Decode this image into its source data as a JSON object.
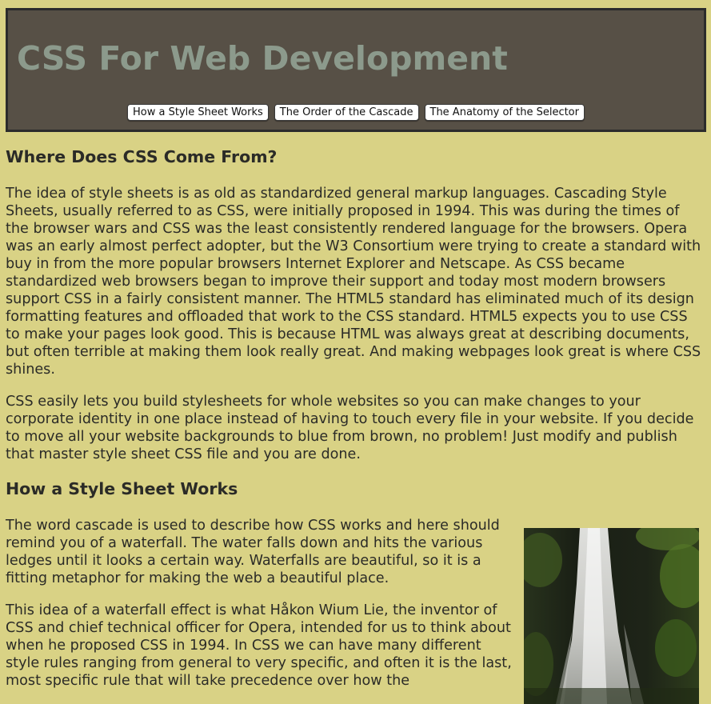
{
  "header": {
    "title": "CSS For Web Development",
    "nav": [
      {
        "label": "How a Style Sheet Works"
      },
      {
        "label": "The Order of the Cascade"
      },
      {
        "label": "The Anatomy of the Selector"
      }
    ]
  },
  "sections": [
    {
      "heading": "Where Does CSS Come From?",
      "paragraphs": [
        "The idea of style sheets is as old as standardized general markup languages. Cascading Style Sheets, usually referred to as CSS, were initially proposed in 1994. This was during the times of the browser wars and CSS was the least consistently rendered language for the browsers. Opera was an early almost perfect adopter, but the W3 Consortium were trying to create a standard with buy in from the more popular browsers Internet Explorer and Netscape. As CSS became standardized web browsers began to improve their support and today most modern browsers support CSS in a fairly consistent manner. The HTML5 standard has eliminated much of its design formatting features and offloaded that work to the CSS standard. HTML5 expects you to use CSS to make your pages look good. This is because HTML was always great at describing documents, but often terrible at making them look really great. And making webpages look great is where CSS shines.",
        "CSS easily lets you build stylesheets for whole websites so you can make changes to your corporate identity in one place instead of having to touch every file in your website. If you decide to move all your website backgrounds to blue from brown, no problem! Just modify and publish that master style sheet CSS file and you are done."
      ]
    },
    {
      "heading": "How a Style Sheet Works",
      "paragraphs": [
        "The word cascade is used to describe how CSS works and here should remind you of a waterfall. The water falls down and hits the various ledges until it looks a certain way. Waterfalls are beautiful, so it is a fitting metaphor for making the web a beautiful place.",
        "This idea of a waterfall effect is what Håkon Wium Lie, the inventor of CSS and chief technical officer for Opera, intended for us to think about when he proposed CSS in 1994. In CSS we can have many different style rules ranging from general to very specific, and often it is the last, most specific rule that will take precedence over how the"
      ]
    }
  ],
  "colors": {
    "page_background": "#d9d285",
    "header_background": "#575046",
    "title_color": "#8c9a8c",
    "text_color": "#2b2b27"
  },
  "image": {
    "subject": "waterfall-photo"
  }
}
